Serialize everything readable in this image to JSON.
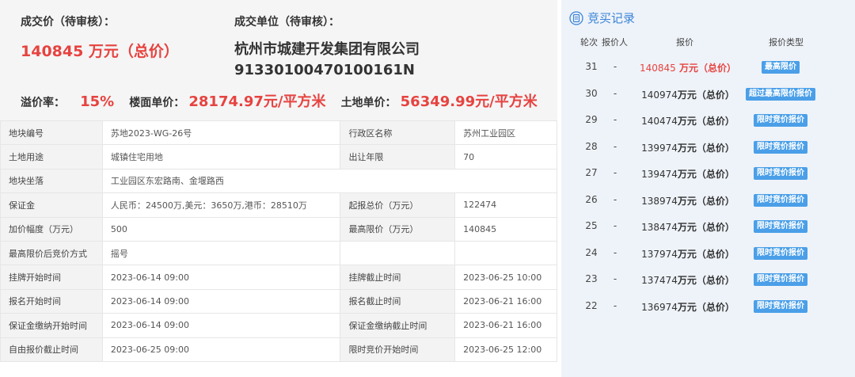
{
  "summary": {
    "deal_price_label": "成交价（待审核）：",
    "deal_price": "140845 万元（总价）",
    "deal_unit_label": "成交单位（待审核）：",
    "company_name": "杭州市城建开发集团有限公司",
    "company_code": "91330100470100161N",
    "premium_rate_label": "溢价率：",
    "premium_rate": "15%",
    "floor_price_label": "楼面单价：",
    "floor_price": "28174.97元/平方米",
    "land_price_label": "土地单价：",
    "land_price": "56349.99元/平方米"
  },
  "info": {
    "plot_no_label": "地块编号",
    "plot_no": "苏地2023-WG-26号",
    "district_label": "行政区名称",
    "district": "苏州工业园区",
    "usage_label": "土地用途",
    "usage": "城镇住宅用地",
    "term_label": "出让年限",
    "term": "70",
    "location_label": "地块坐落",
    "location": "工业园区东宏路南、金堰路西",
    "deposit_label": "保证金",
    "deposit": "人民币：24500万,美元：3650万,港币：28510万",
    "start_price_label": "起报总价（万元）",
    "start_price": "122474",
    "increment_label": "加价幅度（万元）",
    "increment": "500",
    "max_price_label": "最高限价（万元）",
    "max_price": "140845",
    "method_label": "最高限价后竞价方式",
    "method": "摇号",
    "listing_start_label": "挂牌开始时间",
    "listing_start": "2023-06-14 09:00",
    "listing_end_label": "挂牌截止时间",
    "listing_end": "2023-06-25 10:00",
    "signup_start_label": "报名开始时间",
    "signup_start": "2023-06-14 09:00",
    "signup_end_label": "报名截止时间",
    "signup_end": "2023-06-21 16:00",
    "deposit_start_label": "保证金缴纳开始时间",
    "deposit_start": "2023-06-14 09:00",
    "deposit_end_label": "保证金缴纳截止时间",
    "deposit_end": "2023-06-21 16:00",
    "free_bid_end_label": "自由报价截止时间",
    "free_bid_end": "2023-06-25 09:00",
    "limited_bid_start_label": "限时竞价开始时间",
    "limited_bid_start": "2023-06-25 12:00"
  },
  "records": {
    "title": "竞买记录",
    "icon": "document-icon",
    "headers": {
      "round": "轮次",
      "bidder": "报价人",
      "price": "报价",
      "type": "报价类型"
    },
    "rows": [
      {
        "round": "31",
        "bidder": "-",
        "amount": "140845",
        "unit": " 万元（总价）",
        "type": "最高限价"
      },
      {
        "round": "30",
        "bidder": "-",
        "amount": "140974",
        "unit": "万元（总价）",
        "type": "超过最高限价报价"
      },
      {
        "round": "29",
        "bidder": "-",
        "amount": "140474",
        "unit": "万元（总价）",
        "type": "限时竞价报价"
      },
      {
        "round": "28",
        "bidder": "-",
        "amount": "139974",
        "unit": "万元（总价）",
        "type": "限时竞价报价"
      },
      {
        "round": "27",
        "bidder": "-",
        "amount": "139474",
        "unit": "万元（总价）",
        "type": "限时竞价报价"
      },
      {
        "round": "26",
        "bidder": "-",
        "amount": "138974",
        "unit": "万元（总价）",
        "type": "限时竞价报价"
      },
      {
        "round": "25",
        "bidder": "-",
        "amount": "138474",
        "unit": "万元（总价）",
        "type": "限时竞价报价"
      },
      {
        "round": "24",
        "bidder": "-",
        "amount": "137974",
        "unit": "万元（总价）",
        "type": "限时竞价报价"
      },
      {
        "round": "23",
        "bidder": "-",
        "amount": "137474",
        "unit": "万元（总价）",
        "type": "限时竞价报价"
      },
      {
        "round": "22",
        "bidder": "-",
        "amount": "136974",
        "unit": "万元（总价）",
        "type": "限时竞价报价"
      }
    ]
  },
  "colors": {
    "accent_red": "#e64340",
    "accent_blue": "#3b84d8",
    "badge_blue": "#4a9fe8",
    "panel_bg": "#eef3f9"
  }
}
